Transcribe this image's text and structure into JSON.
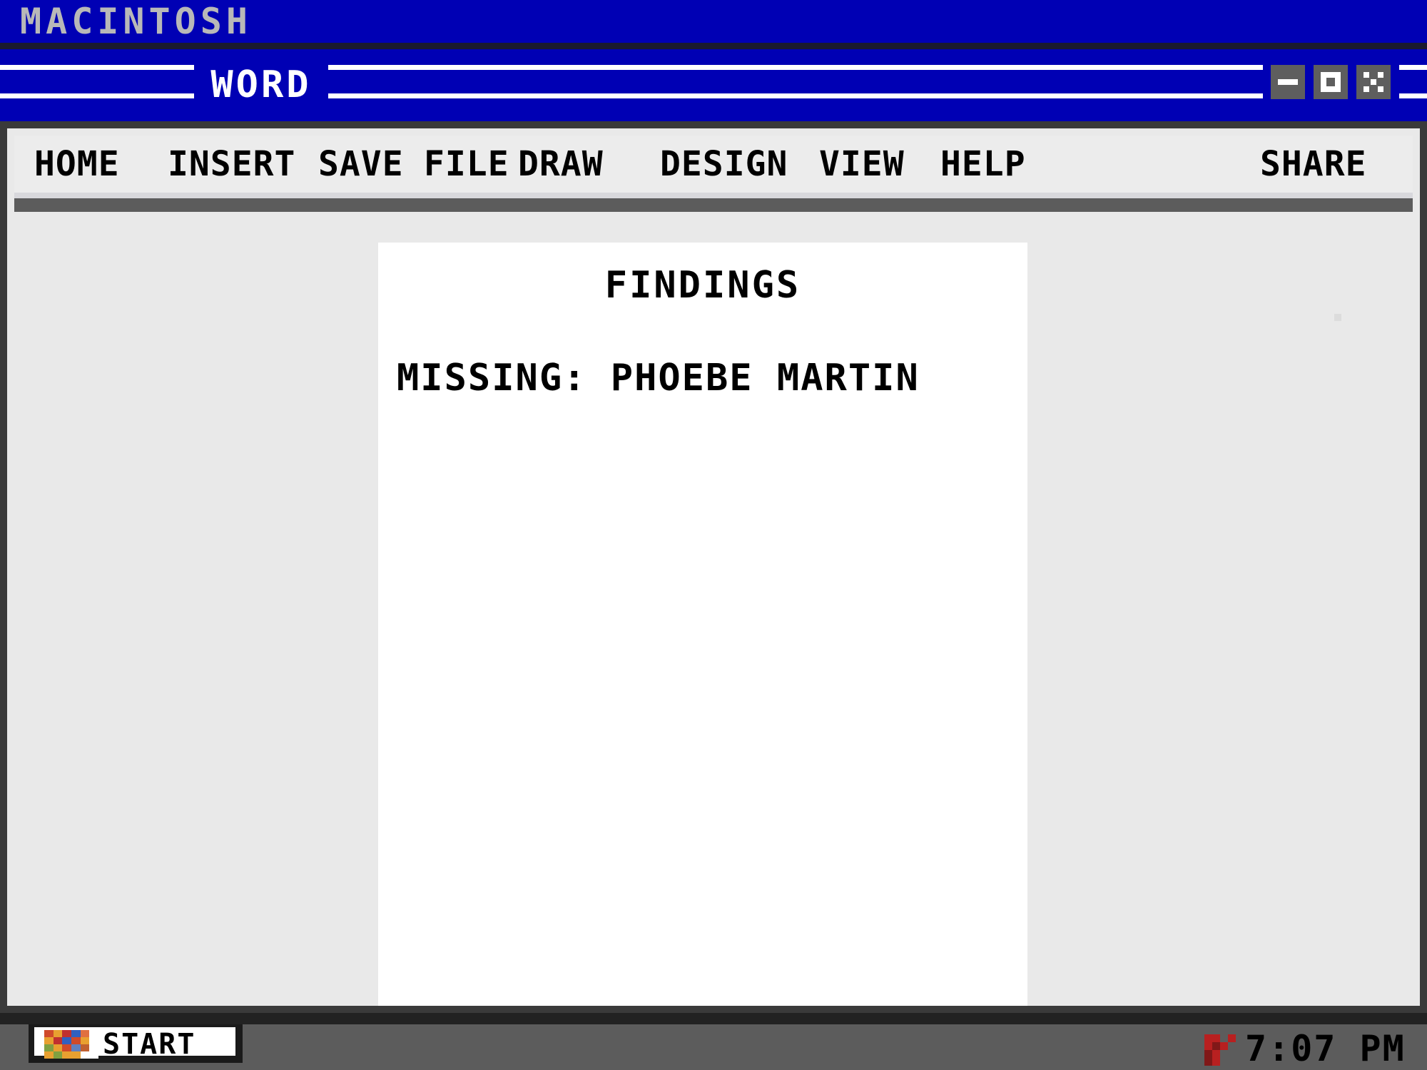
{
  "system": {
    "title": "MACINTOSH"
  },
  "window": {
    "title": "WORD",
    "controls": {
      "minimize_icon": "minimize-icon",
      "maximize_icon": "maximize-icon",
      "close_icon": "close-icon"
    }
  },
  "menu": {
    "items": [
      {
        "label": "HOME"
      },
      {
        "label": "INSERT"
      },
      {
        "label": "SAVE"
      },
      {
        "label": "FILE"
      },
      {
        "label": "DRAW"
      },
      {
        "label": "DESIGN"
      },
      {
        "label": "VIEW"
      },
      {
        "label": "HELP"
      }
    ],
    "share_label": "SHARE"
  },
  "document": {
    "heading": "FINDINGS",
    "lines": [
      "MISSING: PHOEBE MARTIN"
    ]
  },
  "taskbar": {
    "start_label": "START",
    "clock": "7:07 PM"
  },
  "colors": {
    "title_blue": "#0000b4",
    "window_bg": "#e9e9e9",
    "page_bg": "#ffffff",
    "taskbar_gray": "#5c5c5c",
    "button_gray": "#5e5e5e"
  }
}
